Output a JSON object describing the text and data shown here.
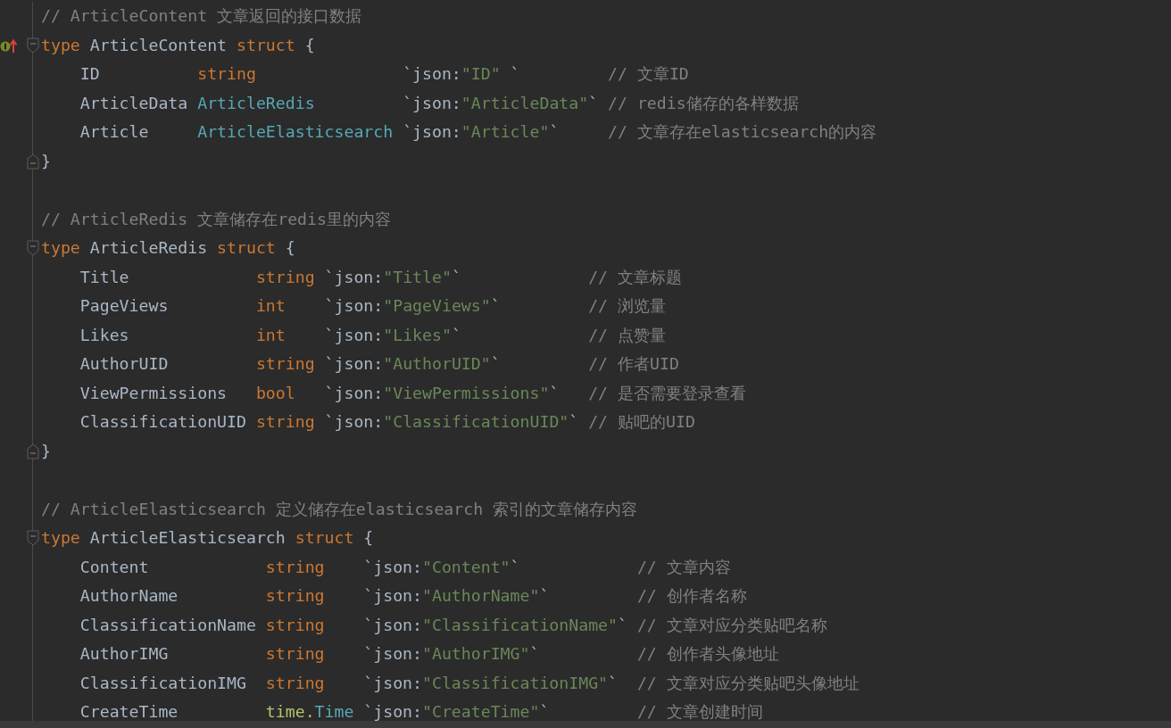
{
  "editor": {
    "lines": [
      {
        "kind": "comment",
        "text": "// ArticleContent 文章返回的接口数据"
      },
      {
        "kind": "decl",
        "implemented": true,
        "keyword": "type",
        "name": "ArticleContent",
        "struct_keyword": "struct",
        "brace": "{"
      },
      {
        "kind": "field",
        "name": "ID",
        "type": {
          "kind": "builtin",
          "name": "string"
        },
        "tag_key": "`json:",
        "tag_value": "\"ID\"",
        "tag_end": " `",
        "comment": "// 文章ID"
      },
      {
        "kind": "field",
        "name": "ArticleData",
        "type": {
          "kind": "named",
          "name": "ArticleRedis"
        },
        "tag_key": "`json:",
        "tag_value": "\"ArticleData\"",
        "tag_end": "`",
        "comment": "// redis储存的各样数据"
      },
      {
        "kind": "field",
        "name": "Article",
        "type": {
          "kind": "named",
          "name": "ArticleElasticsearch"
        },
        "tag_key": "`json:",
        "tag_value": "\"Article\"",
        "tag_end": "`",
        "comment": "// 文章存在elasticsearch的内容"
      },
      {
        "kind": "close",
        "brace": "}"
      },
      {
        "kind": "blank"
      },
      {
        "kind": "comment",
        "text": "// ArticleRedis 文章储存在redis里的内容"
      },
      {
        "kind": "decl",
        "implemented": false,
        "keyword": "type",
        "name": "ArticleRedis",
        "struct_keyword": "struct",
        "brace": "{"
      },
      {
        "kind": "field",
        "name": "Title",
        "type": {
          "kind": "builtin",
          "name": "string"
        },
        "tag_key": "`json:",
        "tag_value": "\"Title\"",
        "tag_end": "`",
        "comment": "// 文章标题"
      },
      {
        "kind": "field",
        "name": "PageViews",
        "type": {
          "kind": "builtin",
          "name": "int"
        },
        "tag_key": "`json:",
        "tag_value": "\"PageViews\"",
        "tag_end": "`",
        "comment": "// 浏览量"
      },
      {
        "kind": "field",
        "name": "Likes",
        "type": {
          "kind": "builtin",
          "name": "int"
        },
        "tag_key": "`json:",
        "tag_value": "\"Likes\"",
        "tag_end": "`",
        "comment": "// 点赞量"
      },
      {
        "kind": "field",
        "name": "AuthorUID",
        "type": {
          "kind": "builtin",
          "name": "string"
        },
        "tag_key": "`json:",
        "tag_value": "\"AuthorUID\"",
        "tag_end": "`",
        "comment": "// 作者UID"
      },
      {
        "kind": "field",
        "name": "ViewPermissions",
        "type": {
          "kind": "builtin",
          "name": "bool"
        },
        "tag_key": "`json:",
        "tag_value": "\"ViewPermissions\"",
        "tag_end": "`",
        "comment": "// 是否需要登录查看"
      },
      {
        "kind": "field",
        "name": "ClassificationUID",
        "type": {
          "kind": "builtin",
          "name": "string"
        },
        "tag_key": "`json:",
        "tag_value": "\"ClassificationUID\"",
        "tag_end": "`",
        "comment": "// 贴吧的UID"
      },
      {
        "kind": "close",
        "brace": "}"
      },
      {
        "kind": "blank"
      },
      {
        "kind": "comment",
        "text": "// ArticleElasticsearch 定义储存在elasticsearch 索引的文章储存内容"
      },
      {
        "kind": "decl",
        "implemented": false,
        "keyword": "type",
        "name": "ArticleElasticsearch",
        "struct_keyword": "struct",
        "brace": "{"
      },
      {
        "kind": "field",
        "name": "Content",
        "type": {
          "kind": "builtin",
          "name": "string"
        },
        "tag_key": "`json:",
        "tag_value": "\"Content\"",
        "tag_end": "`",
        "comment": "// 文章内容"
      },
      {
        "kind": "field",
        "name": "AuthorName",
        "type": {
          "kind": "builtin",
          "name": "string"
        },
        "tag_key": "`json:",
        "tag_value": "\"AuthorName\"",
        "tag_end": "`",
        "comment": "// 创作者名称"
      },
      {
        "kind": "field",
        "name": "ClassificationName",
        "type": {
          "kind": "builtin",
          "name": "string"
        },
        "tag_key": "`json:",
        "tag_value": "\"ClassificationName\"",
        "tag_end": "`",
        "comment": "// 文章对应分类贴吧名称"
      },
      {
        "kind": "field",
        "name": "AuthorIMG",
        "type": {
          "kind": "builtin",
          "name": "string"
        },
        "tag_key": "`json:",
        "tag_value": "\"AuthorIMG\"",
        "tag_end": "`",
        "comment": "// 创作者头像地址"
      },
      {
        "kind": "field",
        "name": "ClassificationIMG",
        "type": {
          "kind": "builtin",
          "name": "string"
        },
        "tag_key": "`json:",
        "tag_value": "\"ClassificationIMG\"",
        "tag_end": "`",
        "comment": "// 文章对应分类贴吧头像地址"
      },
      {
        "kind": "field",
        "name": "CreateTime",
        "type": {
          "kind": "qualified",
          "package": "time.",
          "name": "Time"
        },
        "tag_key": "`json:",
        "tag_value": "\"CreateTime\"",
        "tag_end": "`",
        "comment": "// 文章创建时间"
      }
    ]
  }
}
